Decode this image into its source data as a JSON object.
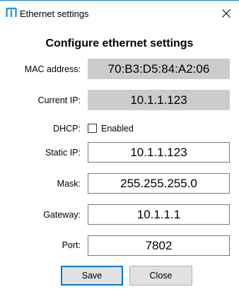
{
  "window": {
    "title": "Ethernet settings",
    "accent_color": "#1f79c9",
    "icon": "app-logo-icon",
    "close_icon": "close-icon"
  },
  "heading": "Configure ethernet settings",
  "fields": {
    "mac": {
      "label": "MAC address:",
      "value": "70:B3:D5:84:A2:06"
    },
    "current_ip": {
      "label": "Current IP:",
      "value": "10.1.1.123"
    },
    "dhcp": {
      "label": "DHCP:",
      "checkbox_label": "Enabled",
      "checked": false
    },
    "static_ip": {
      "label": "Static IP:",
      "value": "10.1.1.123"
    },
    "mask": {
      "label": "Mask:",
      "value": "255.255.255.0"
    },
    "gateway": {
      "label": "Gateway:",
      "value": "10.1.1.1"
    },
    "port": {
      "label": "Port:",
      "value": "7802"
    }
  },
  "buttons": {
    "save": "Save",
    "close": "Close"
  }
}
